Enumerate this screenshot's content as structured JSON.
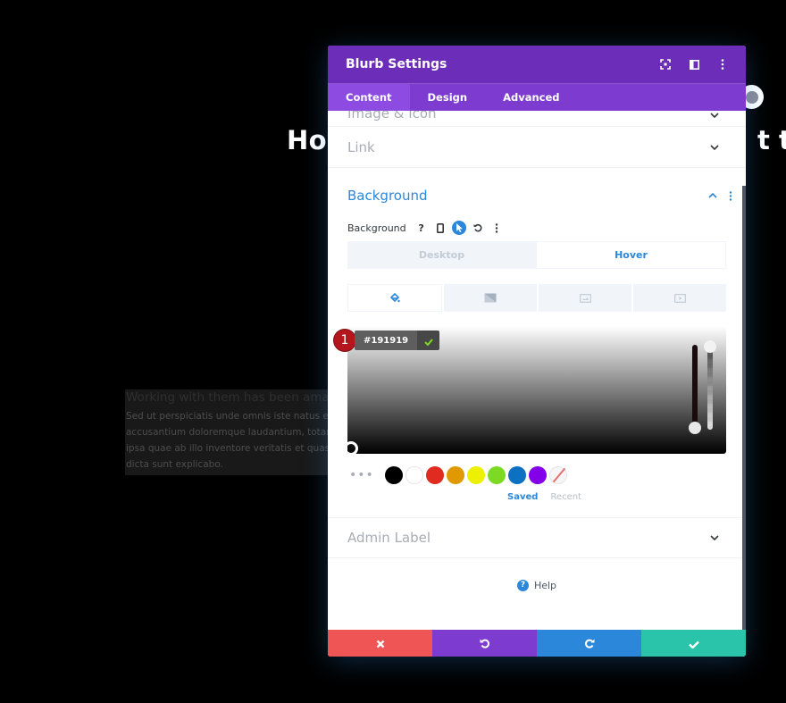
{
  "background_page": {
    "heading_left": "How",
    "heading_right": "t th",
    "card_title": "Working with them has been amazing",
    "card_body_lines": [
      "Sed ut perspiciatis unde omnis iste natus error",
      "accusantium doloremque laudantium, totam",
      "ipsa quae ab illo inventore veritatis et quasi ar",
      "dicta sunt explicabo."
    ]
  },
  "modal": {
    "title": "Blurb Settings",
    "header_icons": [
      "fullscreen-icon",
      "sidebar-toggle-icon",
      "more-options-icon"
    ],
    "tabs": [
      {
        "label": "Content",
        "active": true
      },
      {
        "label": "Design",
        "active": false
      },
      {
        "label": "Advanced",
        "active": false
      }
    ],
    "sections": {
      "image_icon": "Image & Icon",
      "link": "Link",
      "background": "Background",
      "admin_label": "Admin Label"
    },
    "background_field": {
      "label": "Background",
      "states": [
        {
          "label": "Desktop",
          "active": false
        },
        {
          "label": "Hover",
          "active": true
        }
      ],
      "type_tabs": [
        "color-fill-icon",
        "gradient-icon",
        "image-icon",
        "video-icon"
      ],
      "active_type": "color-fill-icon",
      "color_hex": "#191919",
      "step_number": "1",
      "swatches": [
        "#000000",
        "#ffffff",
        "#e02b20",
        "#e09900",
        "#edf000",
        "#7cda24",
        "#0c71c3",
        "#8300e9"
      ],
      "palette_tabs": {
        "saved": "Saved",
        "recent": "Recent"
      }
    },
    "help_label": "Help",
    "footer_buttons": [
      "cancel",
      "undo",
      "redo",
      "save"
    ],
    "colors": {
      "header": "#6c2eb9",
      "tabs": "#7e3bd0",
      "accent_blue": "#2b87da",
      "cancel": "#ef5555",
      "save": "#29c4a9"
    }
  }
}
